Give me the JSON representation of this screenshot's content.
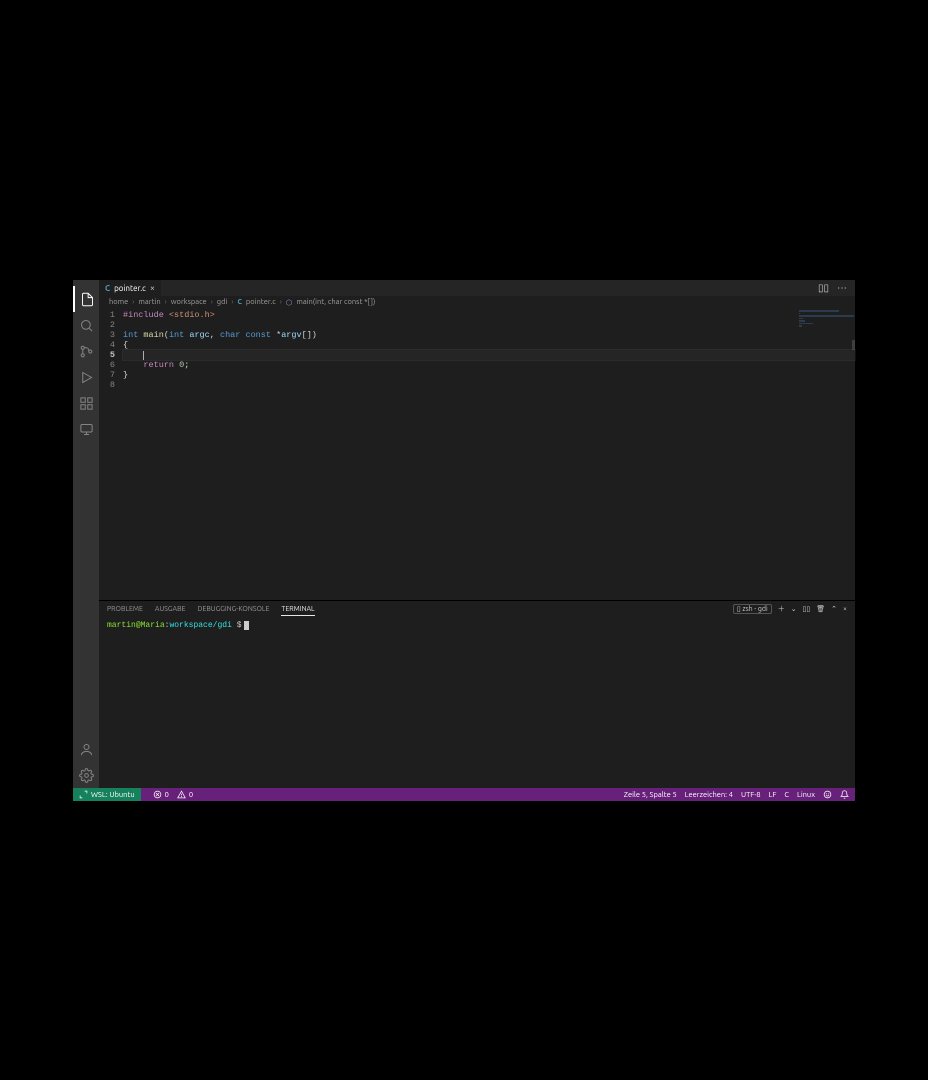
{
  "tab": {
    "filename": "pointer.c",
    "lang_badge": "C",
    "close_glyph": "×"
  },
  "tab_actions": {
    "split_glyph": "▯▯",
    "more_glyph": "⋯"
  },
  "breadcrumbs": {
    "parts": [
      "home",
      "martin",
      "workspace",
      "gdi"
    ],
    "file_badge": "C",
    "file": "pointer.c",
    "symbol_icon": "⬡",
    "symbol": "main(int, char const *[])"
  },
  "editor": {
    "lines": [
      [
        {
          "c": "tok-mag",
          "t": "#include"
        },
        {
          "c": "tok-pun",
          "t": " "
        },
        {
          "c": "tok-str",
          "t": "<stdio.h>"
        }
      ],
      [],
      [
        {
          "c": "tok-kw",
          "t": "int"
        },
        {
          "c": "tok-pun",
          "t": " "
        },
        {
          "c": "tok-fn",
          "t": "main"
        },
        {
          "c": "tok-pun",
          "t": "("
        },
        {
          "c": "tok-kw",
          "t": "int"
        },
        {
          "c": "tok-pun",
          "t": " "
        },
        {
          "c": "tok-var",
          "t": "argc"
        },
        {
          "c": "tok-pun",
          "t": ", "
        },
        {
          "c": "tok-kw",
          "t": "char"
        },
        {
          "c": "tok-pun",
          "t": " "
        },
        {
          "c": "tok-kw",
          "t": "const"
        },
        {
          "c": "tok-pun",
          "t": " *"
        },
        {
          "c": "tok-var",
          "t": "argv"
        },
        {
          "c": "tok-pun",
          "t": "[])"
        }
      ],
      [
        {
          "c": "tok-pun",
          "t": "{"
        }
      ],
      [
        {
          "c": "tok-pun",
          "t": "    "
        }
      ],
      [
        {
          "c": "tok-pun",
          "t": "    "
        },
        {
          "c": "tok-mag",
          "t": "return"
        },
        {
          "c": "tok-pun",
          "t": " "
        },
        {
          "c": "tok-num",
          "t": "0"
        },
        {
          "c": "tok-pun",
          "t": ";"
        }
      ],
      [
        {
          "c": "tok-pun",
          "t": "}"
        }
      ],
      []
    ],
    "current_line": 5
  },
  "panel": {
    "tabs": {
      "problems": "PROBLEME",
      "output": "AUSGABE",
      "debug": "DEBUGGING-KONSOLE",
      "terminal": "TERMINAL"
    },
    "shell_label": "zsh - gdi",
    "terminal_line": {
      "user": "martin",
      "host": "Maria",
      "sep": "@",
      "path": "workspace/gdi",
      "prompt": "$"
    }
  },
  "status": {
    "remote": "WSL: Ubuntu",
    "errors": "0",
    "warnings": "0",
    "cursor": "Zeile 5, Spalte 5",
    "spaces": "Leerzeichen: 4",
    "encoding": "UTF-8",
    "eol": "LF",
    "language": "C",
    "os": "Linux"
  }
}
